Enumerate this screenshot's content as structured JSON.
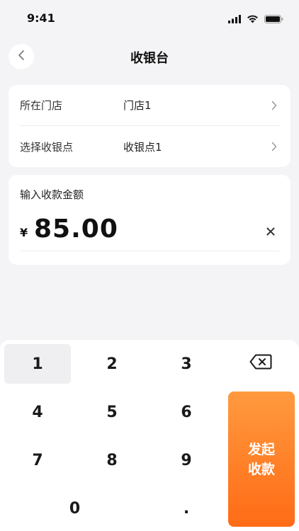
{
  "status_bar": {
    "time": "9:41"
  },
  "nav": {
    "title": "收银台"
  },
  "store": {
    "rows": [
      {
        "label": "所在门店",
        "value": "门店1"
      },
      {
        "label": "选择收银点",
        "value": "收银点1"
      }
    ]
  },
  "amount": {
    "label": "输入收款金额",
    "currency": "¥",
    "value": "85.00"
  },
  "keypad": {
    "keys": [
      "1",
      "2",
      "3",
      "4",
      "5",
      "6",
      "7",
      "8",
      "9",
      "0",
      "."
    ],
    "submit_line1": "发起",
    "submit_line2": "收款"
  },
  "colors": {
    "accent": "#ff7a22",
    "background": "#f4f4f6"
  }
}
